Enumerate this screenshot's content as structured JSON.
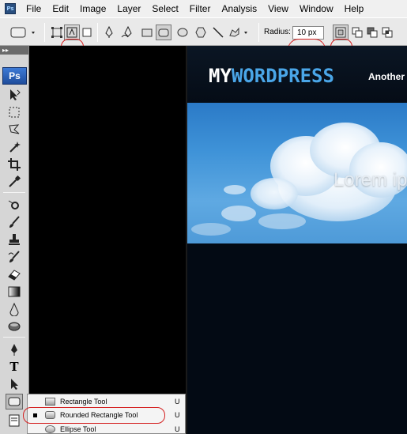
{
  "menubar": {
    "app_icon_text": "Ps",
    "items": [
      "File",
      "Edit",
      "Image",
      "Layer",
      "Select",
      "Filter",
      "Analysis",
      "View",
      "Window",
      "Help"
    ]
  },
  "options": {
    "radius_label": "Radius:",
    "radius_value": "10 px"
  },
  "toolbox": {
    "header": "▸▸",
    "logo": "Ps",
    "type_tool": "T"
  },
  "document": {
    "logo_my": "MY",
    "logo_wp": "WORDPRESS",
    "tagline": "Another",
    "hero_text": "Lorem ips",
    "accent_color": "#4aa6e8"
  },
  "flyout": {
    "items": [
      {
        "label": "Rectangle Tool",
        "shortcut": "U",
        "selected": false
      },
      {
        "label": "Rounded Rectangle Tool",
        "shortcut": "U",
        "selected": true
      },
      {
        "label": "Ellipse Tool",
        "shortcut": "U",
        "selected": false
      }
    ]
  },
  "highlight_color": "#d42020"
}
